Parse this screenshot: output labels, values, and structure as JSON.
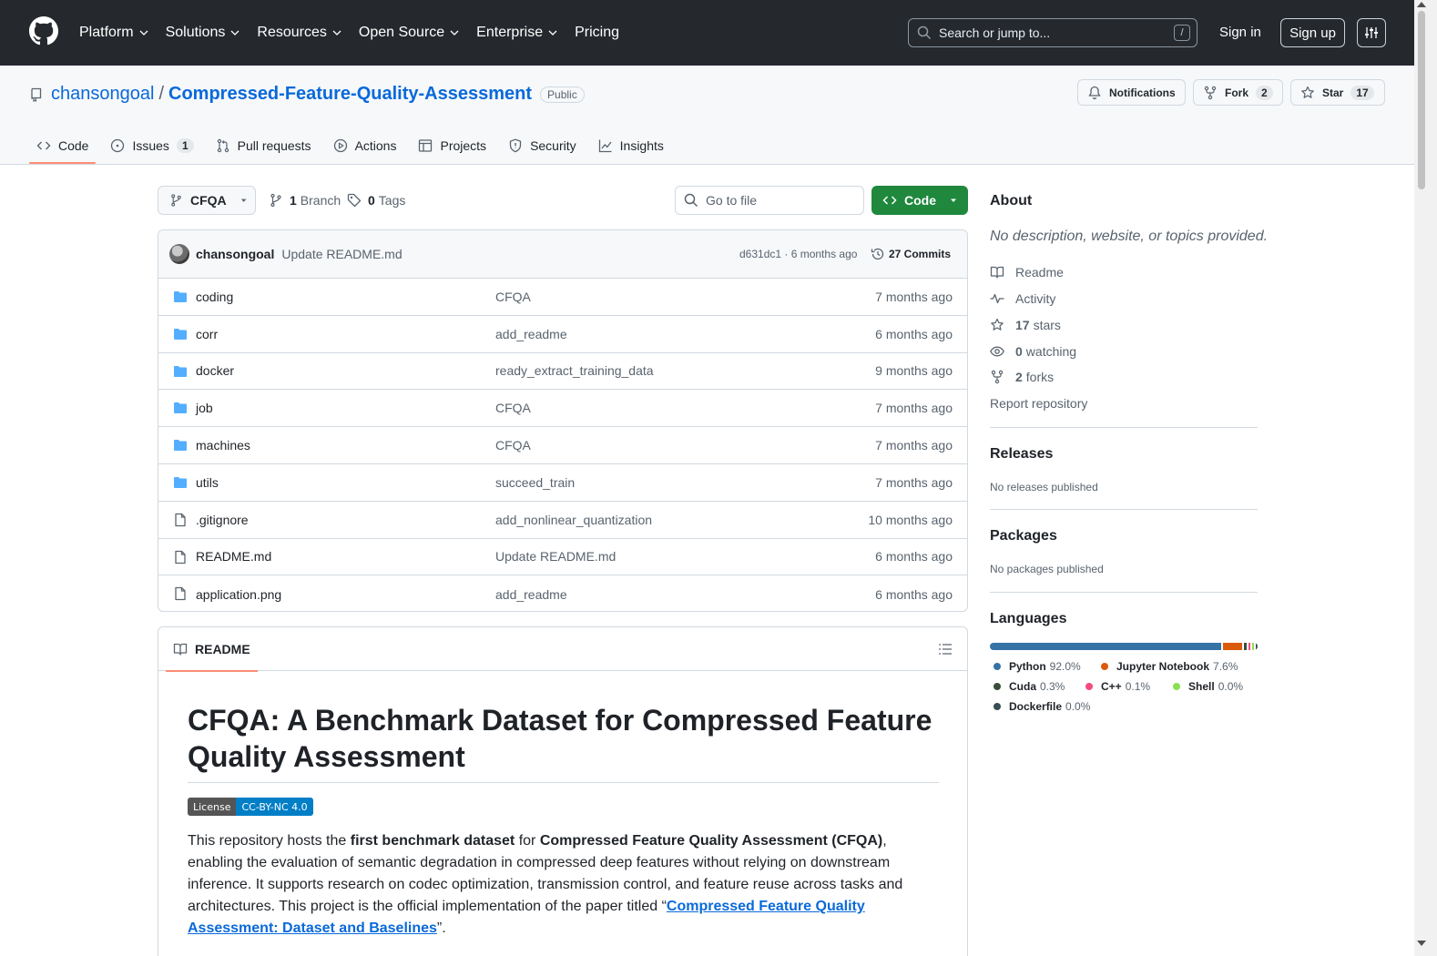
{
  "header": {
    "nav": [
      {
        "label": "Platform",
        "has_menu": true
      },
      {
        "label": "Solutions",
        "has_menu": true
      },
      {
        "label": "Resources",
        "has_menu": true
      },
      {
        "label": "Open Source",
        "has_menu": true
      },
      {
        "label": "Enterprise",
        "has_menu": true
      },
      {
        "label": "Pricing",
        "has_menu": false
      }
    ],
    "search_placeholder": "Search or jump to...",
    "search_shortcut": "/",
    "signin": "Sign in",
    "signup": "Sign up"
  },
  "repo": {
    "owner": "chansongoal",
    "separator": "/",
    "name": "Compressed-Feature-Quality-Assessment",
    "visibility": "Public",
    "notifications": "Notifications",
    "fork_label": "Fork",
    "fork_count": "2",
    "star_label": "Star",
    "star_count": "17"
  },
  "tabs": [
    {
      "label": "Code",
      "icon": "code-icon",
      "active": true
    },
    {
      "label": "Issues",
      "icon": "issue-icon",
      "count": "1"
    },
    {
      "label": "Pull requests",
      "icon": "pull-request-icon"
    },
    {
      "label": "Actions",
      "icon": "play-icon"
    },
    {
      "label": "Projects",
      "icon": "table-icon"
    },
    {
      "label": "Security",
      "icon": "shield-icon"
    },
    {
      "label": "Insights",
      "icon": "graph-icon"
    }
  ],
  "toolbar": {
    "branch": "CFQA",
    "branches_count": "1",
    "branches_label": "Branch",
    "tags_count": "0",
    "tags_label": "Tags",
    "goto_placeholder": "Go to file",
    "code_label": "Code"
  },
  "latest_commit": {
    "author": "chansongoal",
    "message": "Update README.md",
    "hash_time": "d631dc1 · 6 months ago",
    "commits": "27 Commits"
  },
  "files": [
    {
      "name": "coding",
      "type": "dir",
      "message": "CFQA",
      "date": "7 months ago"
    },
    {
      "name": "corr",
      "type": "dir",
      "message": "add_readme",
      "date": "6 months ago"
    },
    {
      "name": "docker",
      "type": "dir",
      "message": "ready_extract_training_data",
      "date": "9 months ago"
    },
    {
      "name": "job",
      "type": "dir",
      "message": "CFQA",
      "date": "7 months ago"
    },
    {
      "name": "machines",
      "type": "dir",
      "message": "CFQA",
      "date": "7 months ago"
    },
    {
      "name": "utils",
      "type": "dir",
      "message": "succeed_train",
      "date": "7 months ago"
    },
    {
      "name": ".gitignore",
      "type": "file",
      "message": "add_nonlinear_quantization",
      "date": "10 months ago"
    },
    {
      "name": "README.md",
      "type": "file",
      "message": "Update README.md",
      "date": "6 months ago"
    },
    {
      "name": "application.png",
      "type": "file",
      "message": "add_readme",
      "date": "6 months ago"
    }
  ],
  "readme": {
    "tab_label": "README",
    "title": "CFQA: A Benchmark Dataset for Compressed Feature Quality Assessment",
    "badge_left": "License",
    "badge_right": "CC-BY-NC 4.0",
    "p_1": "This repository hosts the ",
    "p_b1": "first benchmark dataset",
    "p_2": " for ",
    "p_b2": "Compressed Feature Quality Assessment (CFQA)",
    "p_3": ", enabling the evaluation of semantic degradation in compressed deep features without relying on downstream inference. It supports research on codec optimization, transmission control, and feature reuse across tasks and architectures. This project is the official implementation of the paper titled “",
    "p_link": "Compressed Feature Quality Assessment: Dataset and Baselines",
    "p_4": "”."
  },
  "about": {
    "heading": "About",
    "description": "No description, website, or topics provided.",
    "links": [
      {
        "icon": "book-icon",
        "bold": "",
        "label": "Readme"
      },
      {
        "icon": "pulse-icon",
        "bold": "",
        "label": "Activity"
      },
      {
        "icon": "star-icon",
        "bold": "17",
        "label": "stars"
      },
      {
        "icon": "eye-icon",
        "bold": "0",
        "label": "watching"
      },
      {
        "icon": "fork-icon",
        "bold": "2",
        "label": "forks"
      }
    ],
    "report": "Report repository"
  },
  "releases": {
    "heading": "Releases",
    "text": "No releases published"
  },
  "packages": {
    "heading": "Packages",
    "text": "No packages published"
  },
  "languages": {
    "heading": "Languages",
    "items": [
      {
        "name": "Python",
        "percent": "92.0%",
        "value": 92.0,
        "color": "#3572A5"
      },
      {
        "name": "Jupyter Notebook",
        "percent": "7.6%",
        "value": 7.6,
        "color": "#DA5B0B"
      },
      {
        "name": "Cuda",
        "percent": "0.3%",
        "value": 0.3,
        "color": "#3A4E3A"
      },
      {
        "name": "C++",
        "percent": "0.1%",
        "value": 0.1,
        "color": "#f34b7d"
      },
      {
        "name": "Shell",
        "percent": "0.0%",
        "value": 0.05,
        "color": "#89e051"
      },
      {
        "name": "Dockerfile",
        "percent": "0.0%",
        "value": 0.05,
        "color": "#384d54"
      }
    ]
  }
}
